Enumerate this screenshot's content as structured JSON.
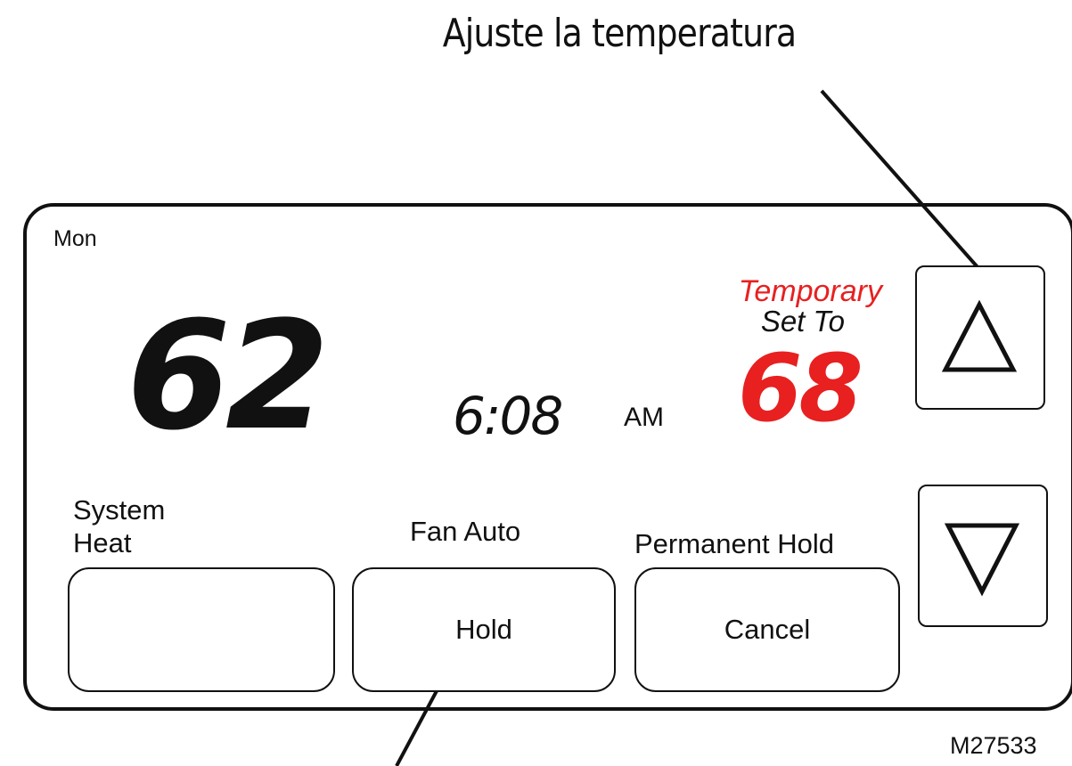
{
  "callout": {
    "title": "Ajuste la temperatura"
  },
  "display": {
    "day": "Mon",
    "current_temp": "62",
    "time": "6:08",
    "ampm": "AM",
    "status_line1": "Temporary",
    "status_line2": "Set To",
    "setpoint": "68"
  },
  "buttons": {
    "system_label_line1": "System",
    "system_label_line2": "Heat",
    "fan_label": "Fan Auto",
    "hold_top_label": "Permanent Hold",
    "hold_button": "Hold",
    "cancel_button": "Cancel"
  },
  "icons": {
    "up": "triangle-up-icon",
    "down": "triangle-down-icon"
  },
  "colors": {
    "accent": "#e82020",
    "ink": "#111111"
  },
  "figure_id": "M27533"
}
